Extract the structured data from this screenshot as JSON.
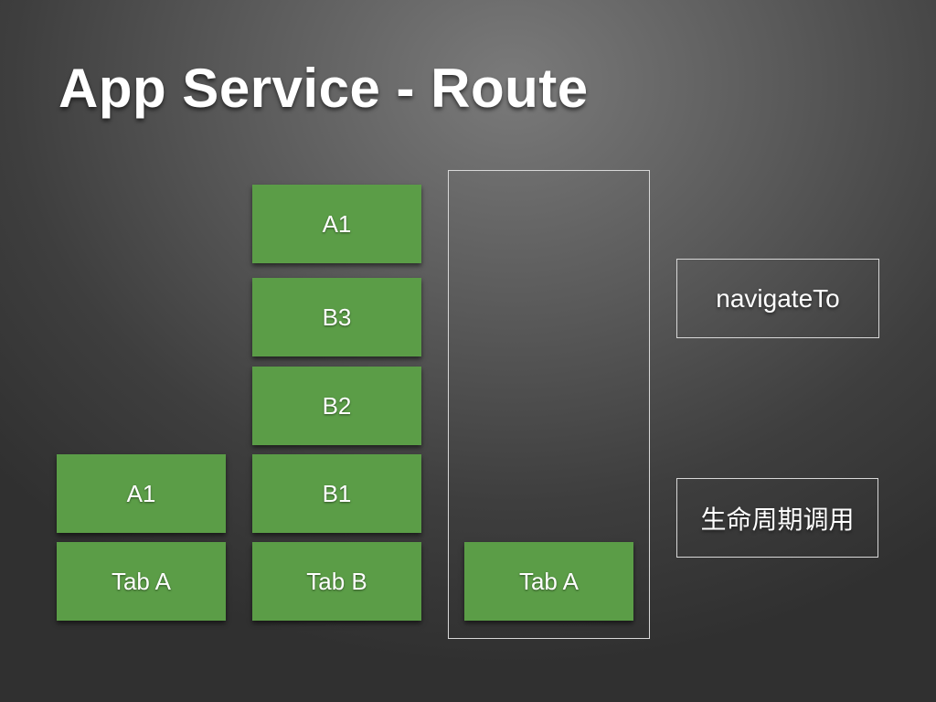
{
  "slide": {
    "title": "App Service - Route"
  },
  "stacks": {
    "left": [
      {
        "label": "A1"
      },
      {
        "label": "Tab A"
      }
    ],
    "middle": [
      {
        "label": "A1"
      },
      {
        "label": "B3"
      },
      {
        "label": "B2"
      },
      {
        "label": "B1"
      },
      {
        "label": "Tab B"
      }
    ],
    "right": [
      {
        "label": "Tab A"
      }
    ]
  },
  "labels": {
    "action": "navigateTo",
    "lifecycle": "生命周期调用"
  },
  "colors": {
    "block_fill": "#5b9d47",
    "frame_border": "#d8d8d8",
    "background": "#3e3e3e"
  }
}
